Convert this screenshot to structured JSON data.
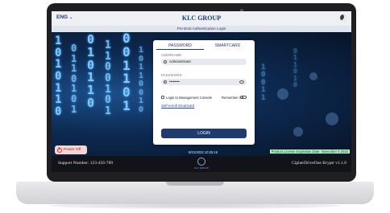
{
  "topbar": {
    "language": "ENG",
    "brand": "KLC GROUP"
  },
  "subtitle": "Pre Boot Authentication Login",
  "tabs": [
    "PASSWORD",
    "SMARTCARD"
  ],
  "form": {
    "username_label": "USERNAME",
    "username_value": "Administrator",
    "password_label": "PASSWORD",
    "password_value": "••••••••",
    "login_console_label": "Login to Management Console",
    "remember_label": "Remember me",
    "enroll_link": "Self-enroll Smartcard",
    "login_button": "LOGIN"
  },
  "power_off": "Power Off",
  "datetime": "8/21/2023 10:25:16",
  "license": "Product License Expiration Date: November 5 2023",
  "footer": {
    "support": "Support Number: 123-456-789",
    "version": "CipherDriveOne Kryptr v1.1.0",
    "logo_text": "KLC GROUP"
  },
  "colors": {
    "brand": "#1e3a6e",
    "license_bg": "#b6f3c6",
    "power_bg": "#f5d6d6"
  },
  "icons": [
    "chevron-down-icon",
    "moon-icon",
    "user-icon",
    "lock-icon",
    "eye-icon",
    "power-icon"
  ]
}
